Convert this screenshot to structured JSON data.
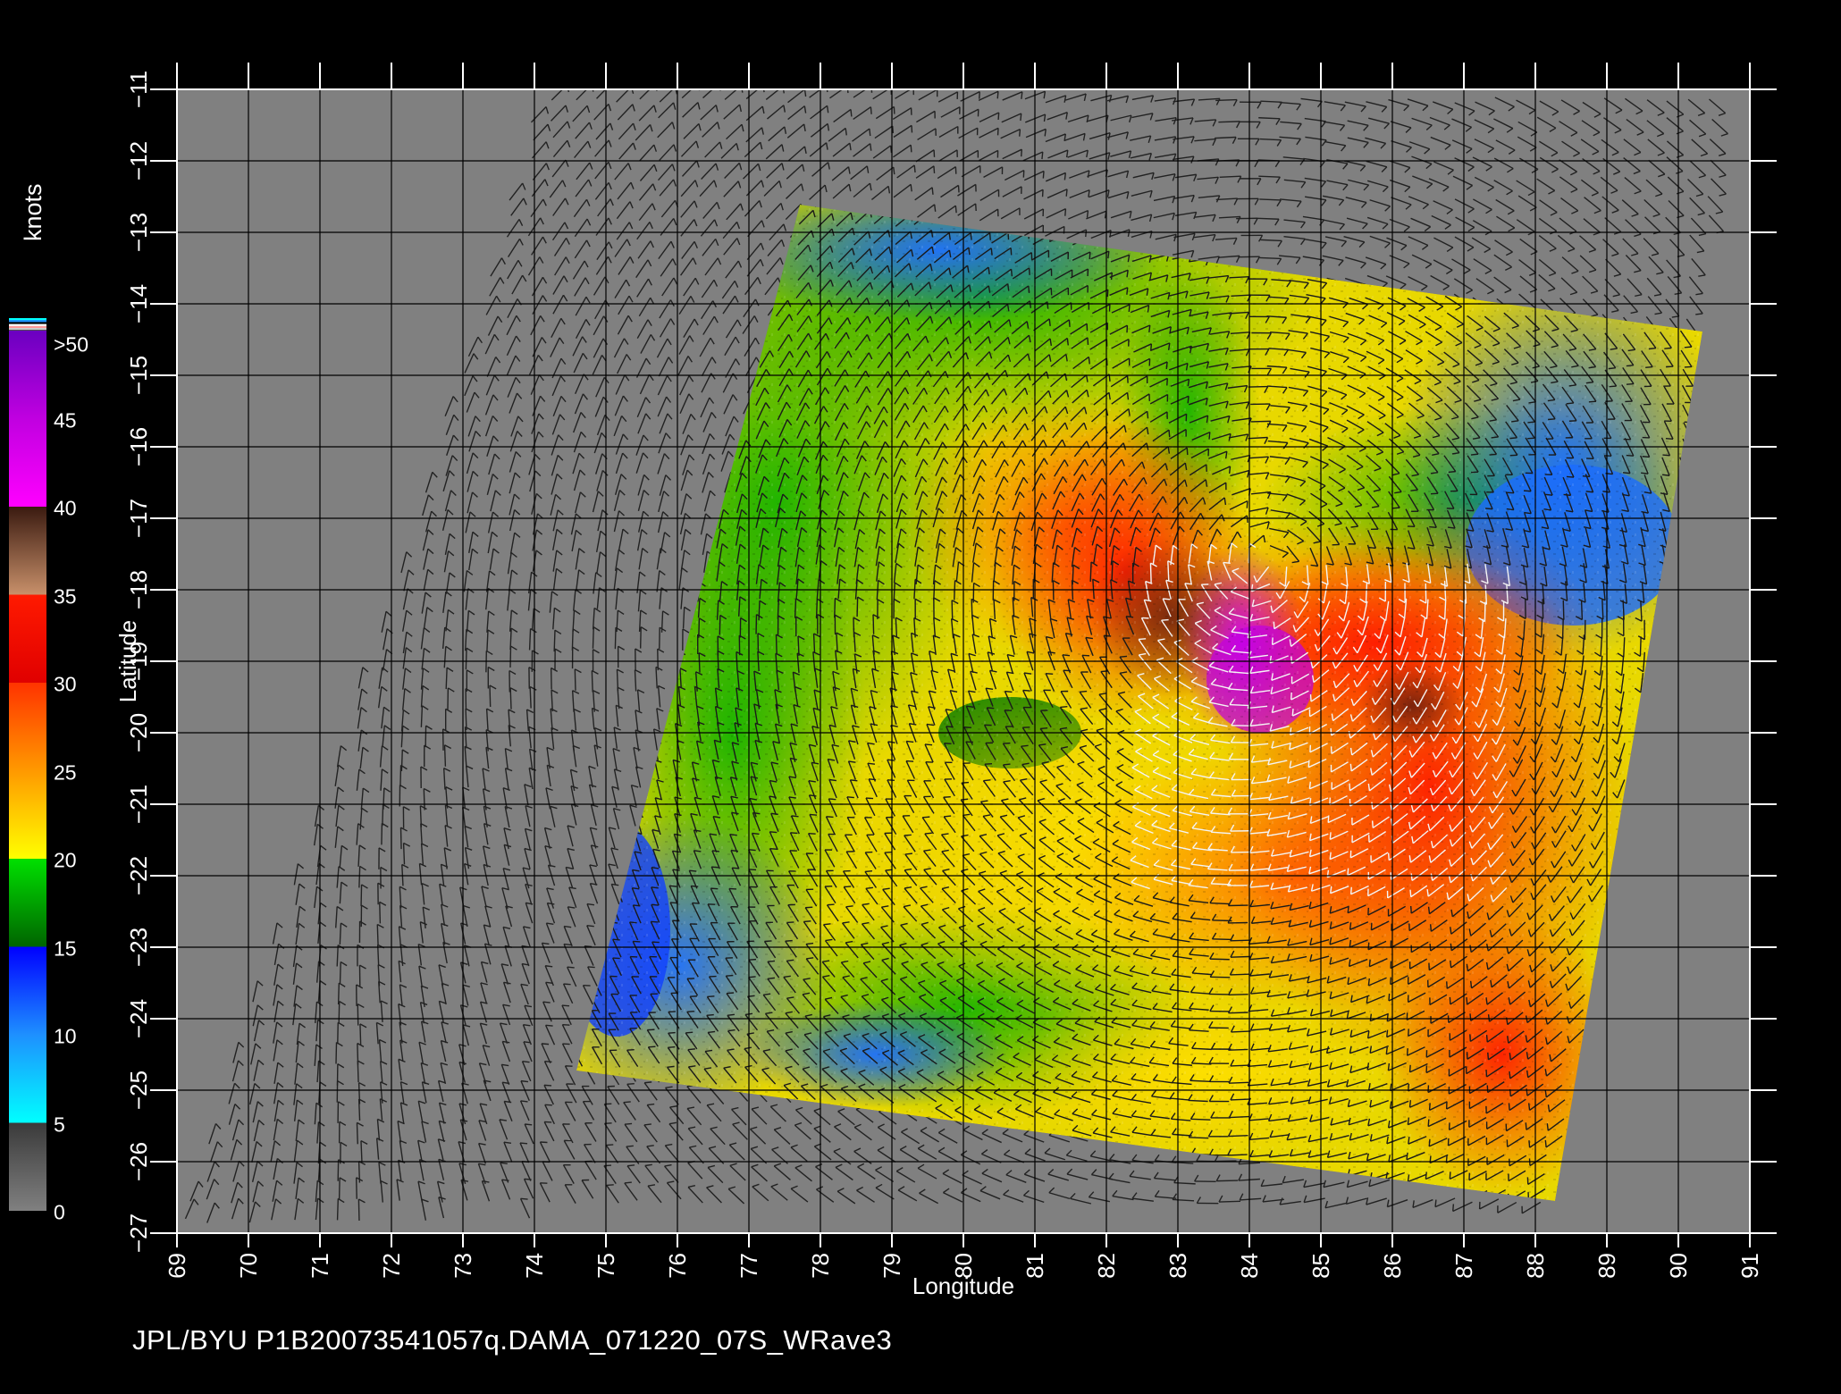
{
  "map": {
    "xlabel": "Longitude",
    "ylabel": "Latitude",
    "lon_range": [
      69,
      91
    ],
    "lat_range": [
      -27,
      -11
    ],
    "lon_ticks": [
      "69",
      "70",
      "71",
      "72",
      "73",
      "74",
      "75",
      "76",
      "77",
      "78",
      "79",
      "80",
      "81",
      "82",
      "83",
      "84",
      "85",
      "86",
      "87",
      "88",
      "89",
      "90",
      "91"
    ],
    "lat_ticks": [
      "−11",
      "−12",
      "−13",
      "−14",
      "−15",
      "−16",
      "−17",
      "−18",
      "−19",
      "−20",
      "−21",
      "−22",
      "−23",
      "−24",
      "−25",
      "−26",
      "−27"
    ],
    "background_color": "#808080",
    "grid": true
  },
  "colorbar": {
    "units": "knots",
    "labels": [
      ">50",
      "45",
      "40",
      "35",
      "30",
      "25",
      "20",
      "15",
      "10",
      "5",
      "0"
    ],
    "segments": [
      {
        "from": 0,
        "to": 5,
        "colors": [
          "#808080",
          "#3a3a3a"
        ]
      },
      {
        "from": 5,
        "to": 10,
        "colors": [
          "#00ffff",
          "#1e90ff"
        ]
      },
      {
        "from": 10,
        "to": 15,
        "colors": [
          "#1e90ff",
          "#0000ff"
        ]
      },
      {
        "from": 15,
        "to": 20,
        "colors": [
          "#006400",
          "#00e000"
        ]
      },
      {
        "from": 20,
        "to": 25,
        "colors": [
          "#ffff00",
          "#ff9900"
        ]
      },
      {
        "from": 25,
        "to": 30,
        "colors": [
          "#ff9900",
          "#ff3300"
        ]
      },
      {
        "from": 30,
        "to": 35,
        "colors": [
          "#e00000",
          "#ff1a00"
        ]
      },
      {
        "from": 35,
        "to": 40,
        "colors": [
          "#c8906a",
          "#3a1a10"
        ]
      },
      {
        "from": 40,
        "to": 45,
        "colors": [
          "#ff00ff",
          "#c000e0"
        ]
      },
      {
        "from": 45,
        "to": 50,
        "colors": [
          "#c000e0",
          "#6a00c0"
        ]
      }
    ]
  },
  "footer_text": "JPL/BYU  P1B20073541057q.DAMA_071220_07S_WRave3"
}
